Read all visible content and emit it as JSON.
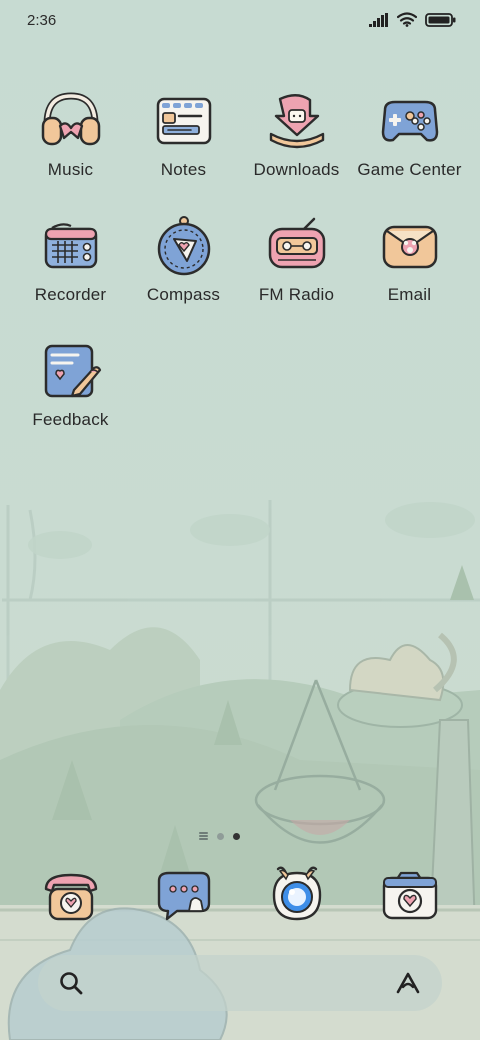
{
  "status_bar": {
    "time": "2:36",
    "signal_icon": "cellular-signal-icon",
    "wifi_icon": "wifi-icon",
    "battery_icon": "battery-full-icon"
  },
  "apps": [
    {
      "label": "Music",
      "icon": "headphones-icon"
    },
    {
      "label": "Notes",
      "icon": "notes-icon"
    },
    {
      "label": "Downloads",
      "icon": "downloads-icon"
    },
    {
      "label": "Game Center",
      "icon": "gamepad-icon"
    },
    {
      "label": "Recorder",
      "icon": "recorder-icon"
    },
    {
      "label": "Compass",
      "icon": "compass-icon"
    },
    {
      "label": "FM Radio",
      "icon": "radio-icon"
    },
    {
      "label": "Email",
      "icon": "email-icon"
    },
    {
      "label": "Feedback",
      "icon": "feedback-icon"
    }
  ],
  "page_indicator": {
    "pages": 2,
    "current": 2
  },
  "dock": [
    {
      "name": "Phone",
      "icon": "phone-icon"
    },
    {
      "name": "Messages",
      "icon": "messages-icon"
    },
    {
      "name": "Browser",
      "icon": "browser-icon"
    },
    {
      "name": "Camera",
      "icon": "camera-icon"
    }
  ],
  "search_bar": {
    "search_icon": "search-icon",
    "assistant_icon": "assistant-icon"
  },
  "colors": {
    "background": "#c9dbd2",
    "icon_blue": "#7fa3d6",
    "icon_pink": "#eea3b1",
    "icon_peach": "#f1c79a",
    "outline": "#2c2c2c"
  }
}
